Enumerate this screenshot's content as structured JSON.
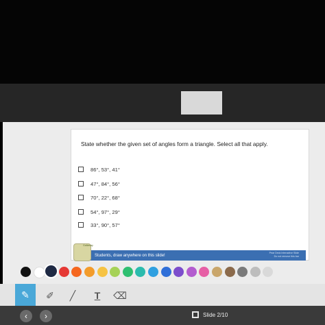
{
  "question": "State whether the given set of angles form a triangle. Select all that apply.",
  "options": [
    "86°, 53°, 41°",
    "47°, 84°, 56°",
    "70°, 22°, 68°",
    "54°, 97°, 29°",
    "33°, 90°, 57°"
  ],
  "banner": {
    "text": "Students, draw anywhere on this slide!",
    "right_line1": "Pear Deck Interactive Slide",
    "right_line2": "Do not remove this bar"
  },
  "mascot_label": "Gallaway",
  "palette": {
    "colors": [
      "#111111",
      "#ffffff",
      "#1f2a44",
      "#e53935",
      "#f5671f",
      "#f39c2b",
      "#f6c343",
      "#a6d257",
      "#2fbf71",
      "#2bbbad",
      "#2fa0e0",
      "#2f6fd8",
      "#7c4dcc",
      "#b35ccf",
      "#e65fa5",
      "#c9a66b",
      "#8b6a4b",
      "#7a7a7a",
      "#bdbdbd",
      "#d9d9d9"
    ],
    "selected_index": 2
  },
  "tools": {
    "icons": [
      "pencil-icon",
      "pen-icon",
      "marker-icon",
      "text-icon",
      "eraser-icon"
    ],
    "text_tool_label": "T"
  },
  "nav": {
    "prev": "‹",
    "next": "›",
    "slide_label": "Slide 2/10"
  }
}
